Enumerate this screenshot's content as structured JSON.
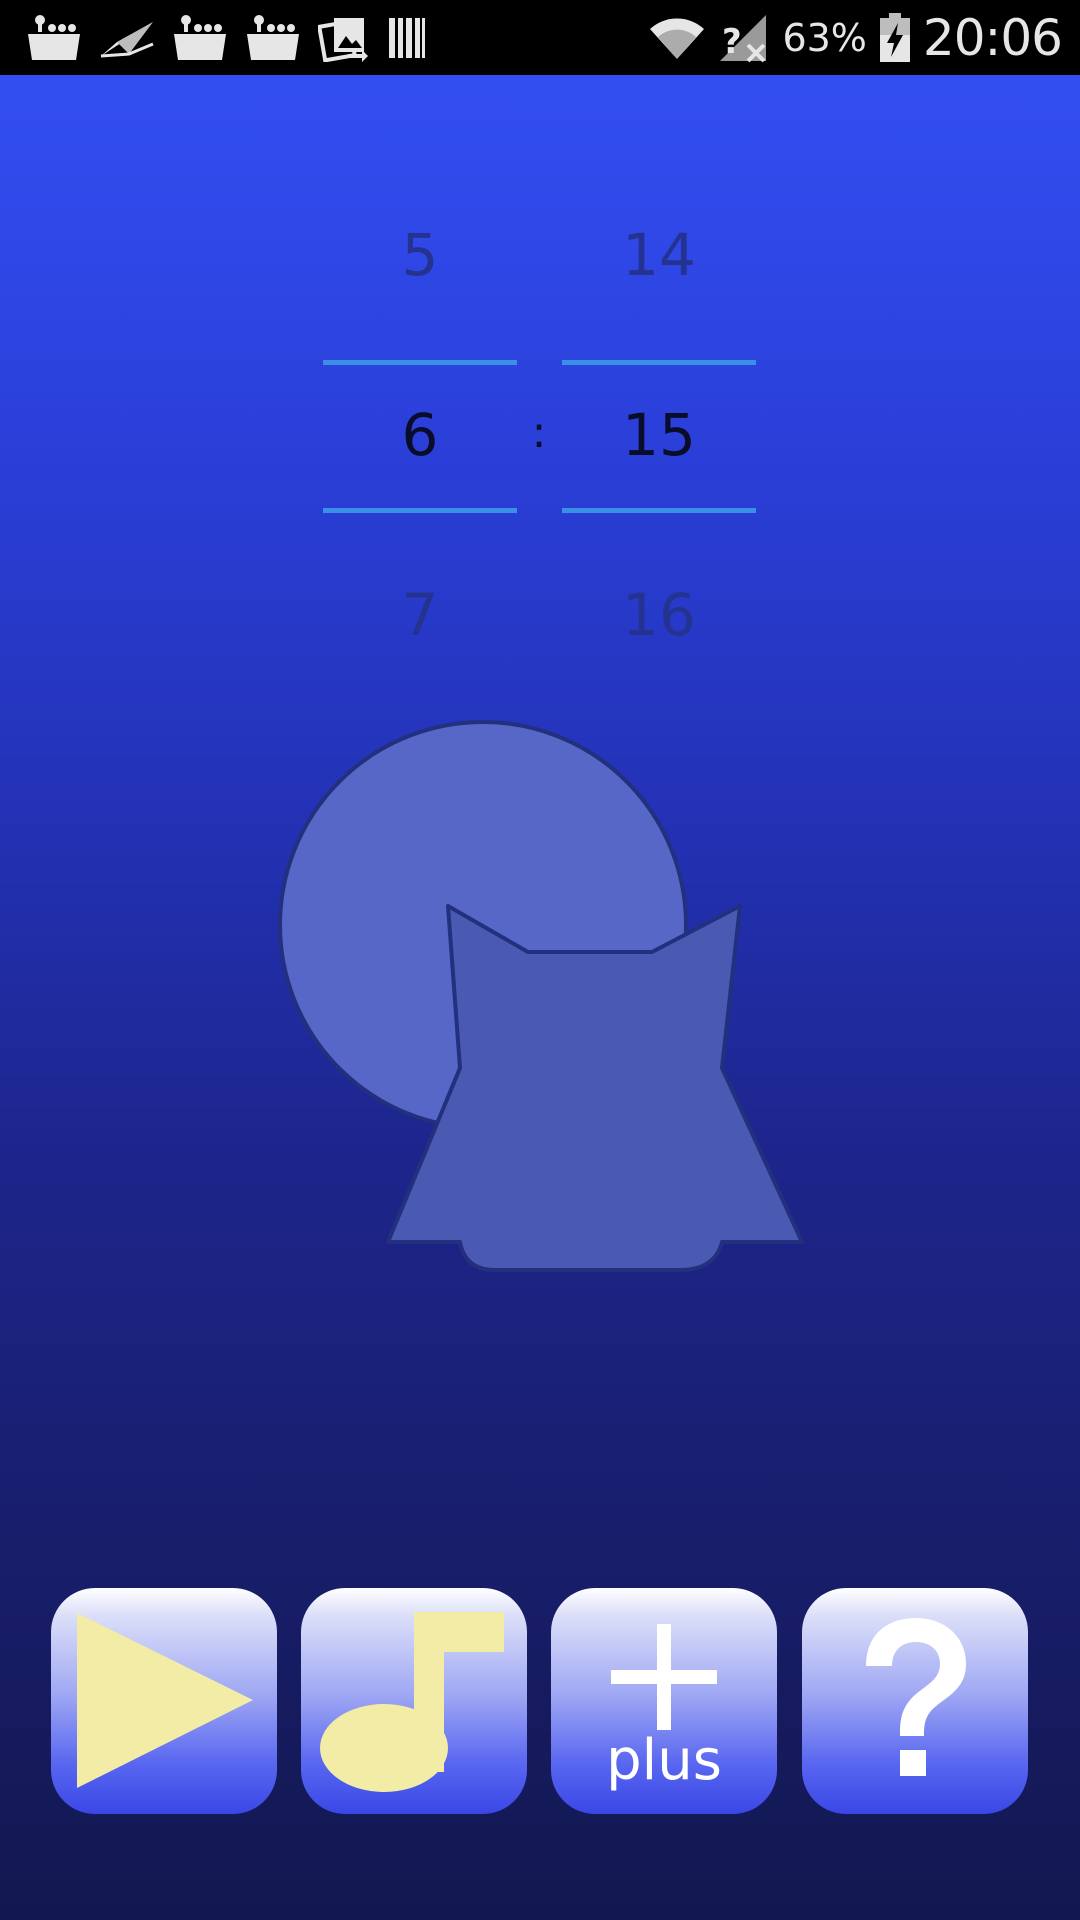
{
  "status_bar": {
    "left_icons": [
      "bucket-icon",
      "paper-plane-icon",
      "bucket-icon",
      "bucket-icon",
      "photo-share-icon",
      "barcode-icon"
    ],
    "battery_percent": "63%",
    "time": "20:06"
  },
  "time_picker": {
    "hours": {
      "previous": "5",
      "selected": "6",
      "next": "7"
    },
    "minutes": {
      "previous": "14",
      "selected": "15",
      "next": "16"
    },
    "separator": ":"
  },
  "toolbar": {
    "plus_label": "plus"
  },
  "colors": {
    "background_top": "#3451f7",
    "background_bottom": "#131750",
    "picker_divider": "#3a8fe6",
    "icon_yellow": "#f2eca6",
    "silhouette": "#4a5ab3"
  }
}
